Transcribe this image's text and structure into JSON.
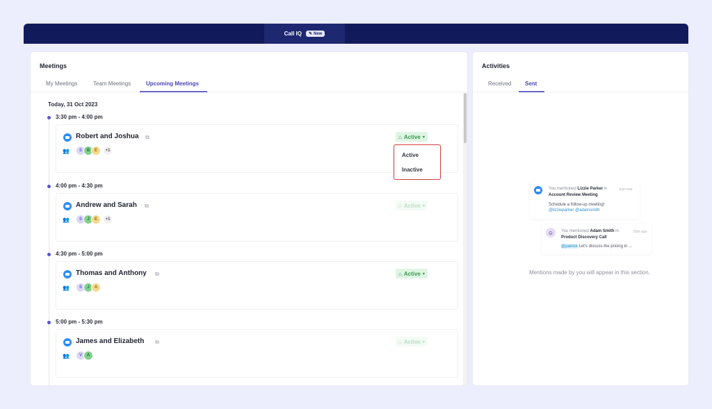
{
  "topbar": {
    "title": "Call IQ",
    "badge": "New"
  },
  "meetings": {
    "title": "Meetings",
    "tabs": [
      {
        "label": "My Meetings",
        "active": false
      },
      {
        "label": "Team Meetings",
        "active": false
      },
      {
        "label": "Upcoming Meetings",
        "active": true
      }
    ],
    "date_label": "Today, 31 Oct 2023",
    "slots": [
      {
        "time": "3:30 pm - 4:00 pm",
        "title": "Robert and Joshua",
        "avatars": [
          "S",
          "B",
          "E"
        ],
        "more": "+1",
        "status": "Active",
        "status_faded": false
      },
      {
        "time": "4:00 pm - 4:30 pm",
        "title": "Andrew and Sarah",
        "avatars": [
          "S",
          "J",
          "E"
        ],
        "more": "+1",
        "status": "Active",
        "status_faded": true
      },
      {
        "time": "4:30 pm - 5:00 pm",
        "title": "Thomas and Anthony",
        "avatars": [
          "S",
          "J",
          "A"
        ],
        "more": "",
        "status": "Active",
        "status_faded": false
      },
      {
        "time": "5:00 pm - 5:30 pm",
        "title": "James and Elizabeth",
        "avatars": [
          "V",
          "A"
        ],
        "more": "",
        "status": "Active",
        "status_faded": true
      }
    ],
    "status_dropdown": {
      "options": [
        "Active",
        "Inactive"
      ]
    }
  },
  "activities": {
    "title": "Activities",
    "tabs": [
      {
        "label": "Received",
        "active": false
      },
      {
        "label": "Sent",
        "active": true
      }
    ],
    "mentions": [
      {
        "prefix": "You mentioned",
        "name": "Lizzie Parker",
        "suffix": "in",
        "meeting": "Account Review Meeting",
        "time": "just now",
        "message": "Schedule a follow-up meeting!",
        "tags": "@lizzieparker @adamsmith"
      },
      {
        "prefix": "You mentioned",
        "name": "Adam Smith",
        "suffix": "in",
        "meeting": "Product Discovery Call",
        "time": "20m ago",
        "tag": "@patrick",
        "message": "Let's discuss the pricing in ..."
      }
    ],
    "empty_text": "Mentions made by you will appear in this section."
  },
  "colors": {
    "accent": "#4a46b8",
    "topbar": "#111a5a",
    "status_green": "#3c9a52",
    "highlight_red": "#d23b3b"
  }
}
